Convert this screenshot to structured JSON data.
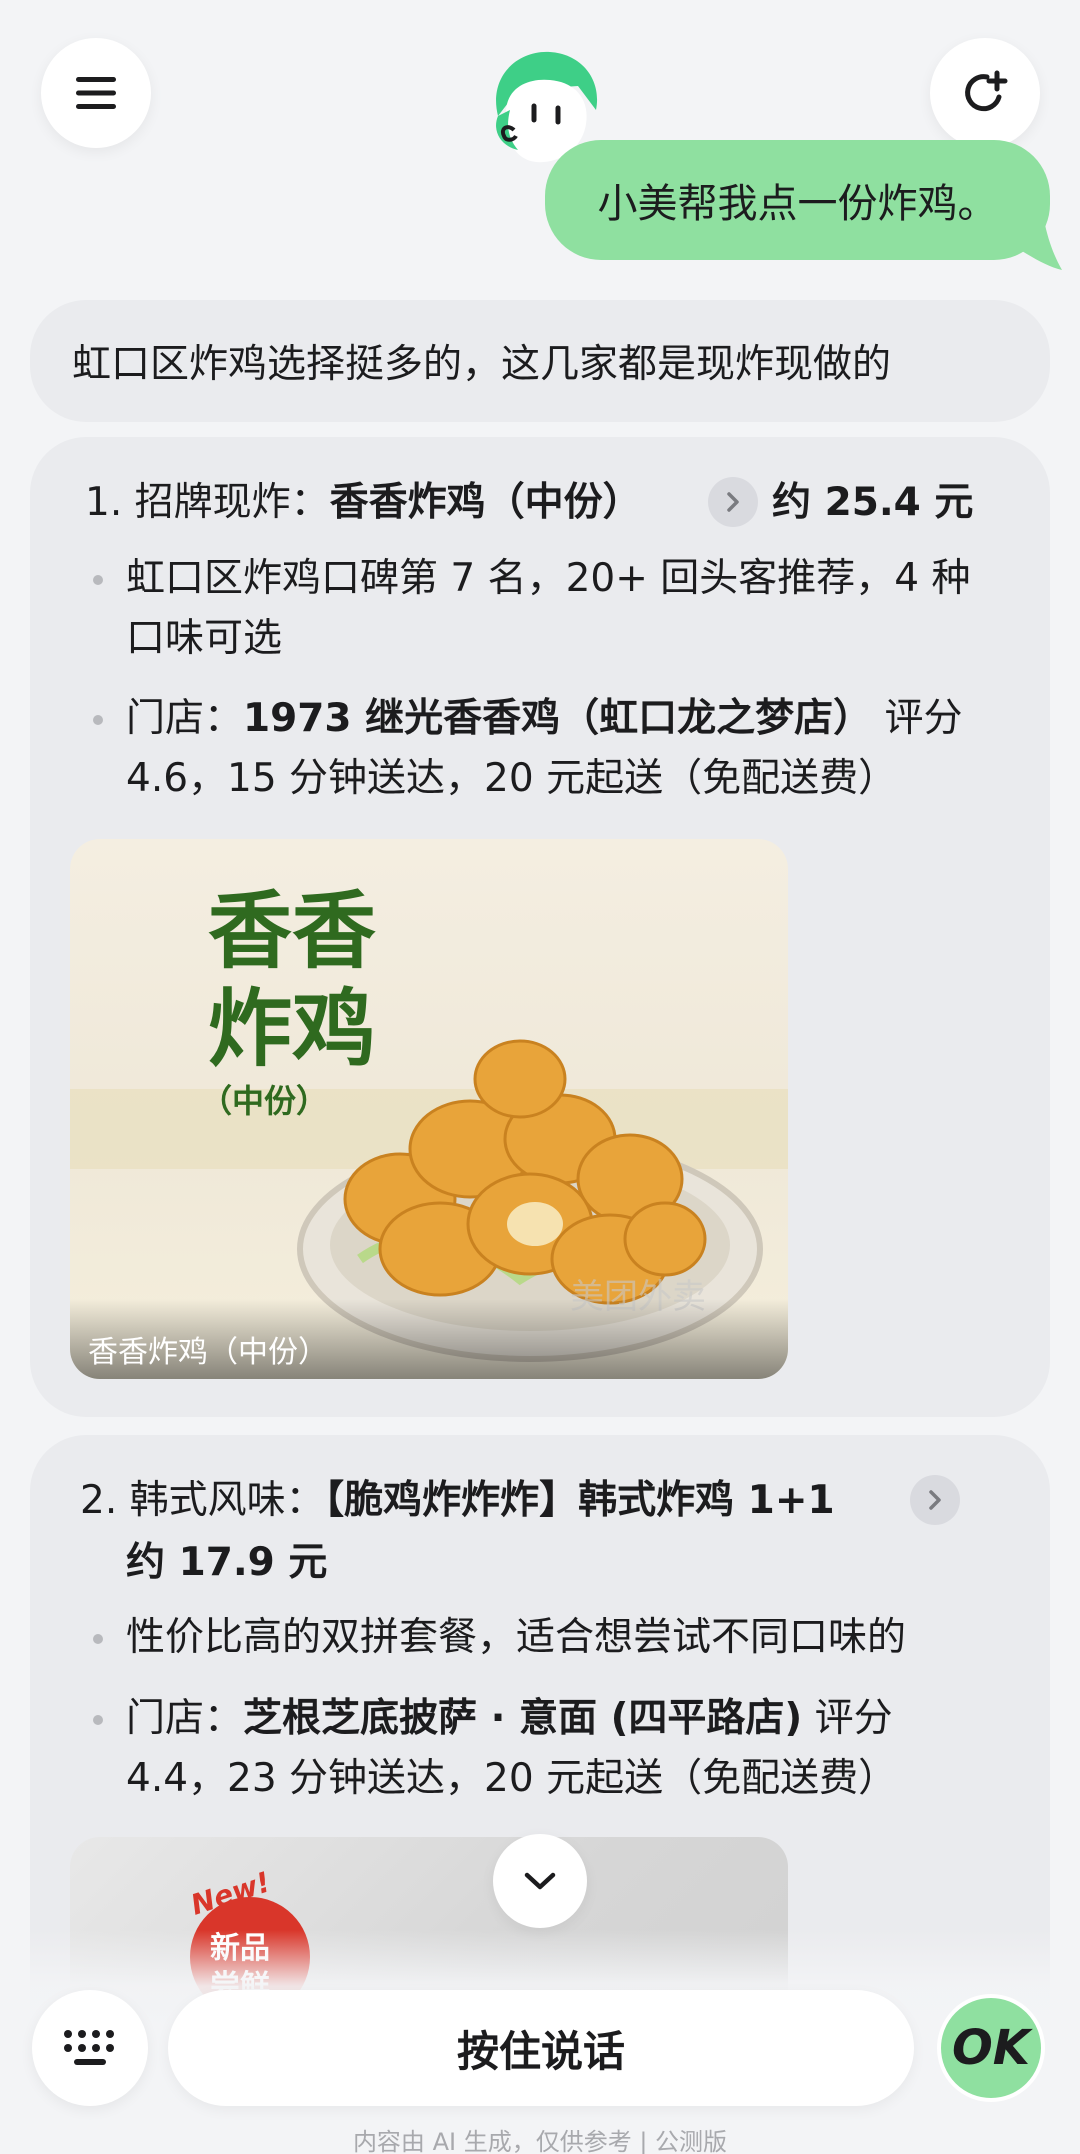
{
  "header": {
    "menu_icon": "hamburger-icon",
    "new_chat_icon": "refresh-plus-icon",
    "avatar": "assistant-mascot"
  },
  "conversation": {
    "user_message": "小美帮我点一份炸鸡。",
    "intro": "虹口区炸鸡选择挺多的，这几家都是现炸现做的"
  },
  "results": [
    {
      "label": "1. 招牌现炸：",
      "name": "香香炸鸡（中份）",
      "price": "约 25.4 元",
      "bullet1": "虹口区炸鸡口碑第 7 名，20+ 回头客推荐，4 种口味可选",
      "bullet2_prefix": "门店：",
      "bullet2_store": "1973 继光香香鸡（虹口龙之梦店）",
      "bullet2_suffix": " 评分 4.6，15 分钟送达，20 元起送（免配送费）",
      "image_title_line1": "香香",
      "image_title_line2": "炸鸡",
      "image_title_line3": "（中份）",
      "image_caption": "香香炸鸡（中份）",
      "image_watermark": "美团外卖"
    },
    {
      "label": "2. 韩式风味：",
      "name": "【脆鸡炸炸炸】韩式炸鸡 1+1",
      "price": "约 17.9 元",
      "bullet1": "性价比高的双拼套餐，适合想尝试不同口味的",
      "bullet2_prefix": "门店：",
      "bullet2_store": "芝根芝底披萨 · 意面 (四平路店)",
      "bullet2_suffix": " 评分 4.4，23 分钟送达，20 元起送（免配送费）",
      "badge_new": "New!",
      "badge_line1": "新品",
      "badge_line2": "尝鲜"
    }
  ],
  "bottom": {
    "voice_label": "按住说话",
    "ok_label": "OK",
    "disclaimer": "内容由 AI 生成，仅供参考 | 公测版"
  },
  "colors": {
    "accent_green": "#8fe0a0",
    "card_bg": "#eaebee",
    "food_title_green": "#2f6a1f"
  }
}
